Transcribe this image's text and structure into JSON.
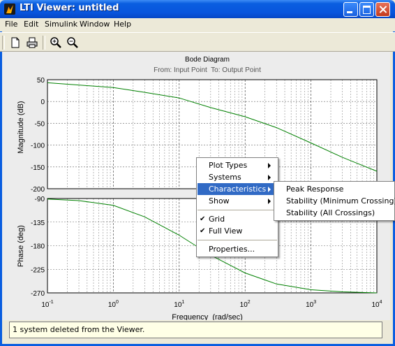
{
  "window": {
    "title": "LTI Viewer: untitled"
  },
  "menubar": {
    "items": [
      "File",
      "Edit",
      "Simulink",
      "Window",
      "Help"
    ]
  },
  "toolbar": {
    "icons": [
      "new-document-icon",
      "print-icon",
      "zoom-in-icon",
      "zoom-out-icon"
    ]
  },
  "chart_data": {
    "type": "line",
    "title": "Bode Diagram",
    "subtitle": "From: Input Point  To: Output Point",
    "xlabel": "Frequency  (rad/sec)",
    "xscale": "log",
    "xlim": [
      0.1,
      10000
    ],
    "x_ticks": [
      {
        "base": "10",
        "exp": "-1"
      },
      {
        "base": "10",
        "exp": "0"
      },
      {
        "base": "10",
        "exp": "1"
      },
      {
        "base": "10",
        "exp": "2"
      },
      {
        "base": "10",
        "exp": "3"
      },
      {
        "base": "10",
        "exp": "4"
      }
    ],
    "grid": true,
    "line_color": "#008000",
    "panels": [
      {
        "ylabel": "Magnitude (dB)",
        "ylim": [
          -200,
          50
        ],
        "yticks": [
          "50",
          "0",
          "-50",
          "-100",
          "-150",
          "-200"
        ],
        "series": [
          {
            "x": [
              0.1,
              1,
              3,
              10,
              30,
              100,
              300,
              1000,
              3000,
              10000
            ],
            "y": [
              43,
              32,
              21,
              8,
              -14,
              -35,
              -60,
              -95,
              -128,
              -160
            ]
          }
        ]
      },
      {
        "ylabel": "Phase (deg)",
        "ylim": [
          -270,
          -90
        ],
        "yticks": [
          "-90",
          "-135",
          "-180",
          "-225",
          "-270"
        ],
        "series": [
          {
            "x": [
              0.1,
              0.3,
              1,
              3,
              10,
              30,
              100,
              300,
              1000,
              3000,
              10000
            ],
            "y": [
              -91,
              -94,
              -103,
              -125,
              -160,
              -198,
              -232,
              -253,
              -264,
              -268,
              -270
            ]
          }
        ]
      }
    ]
  },
  "context_menu": {
    "items": [
      {
        "label": "Plot Types",
        "submenu": true
      },
      {
        "label": "Systems",
        "submenu": true
      },
      {
        "label": "Characteristics",
        "submenu": true,
        "highlighted": true
      },
      {
        "label": "Show",
        "submenu": true
      },
      {
        "label": "Grid",
        "checked": true
      },
      {
        "label": "Full View",
        "checked": true
      },
      {
        "label": "Properties..."
      }
    ],
    "check_glyph": "✔"
  },
  "submenu": {
    "items": [
      "Peak Response",
      "Stability (Minimum Crossing)",
      "Stability (All Crossings)"
    ]
  },
  "status": {
    "text": "1 system deleted from the Viewer."
  }
}
